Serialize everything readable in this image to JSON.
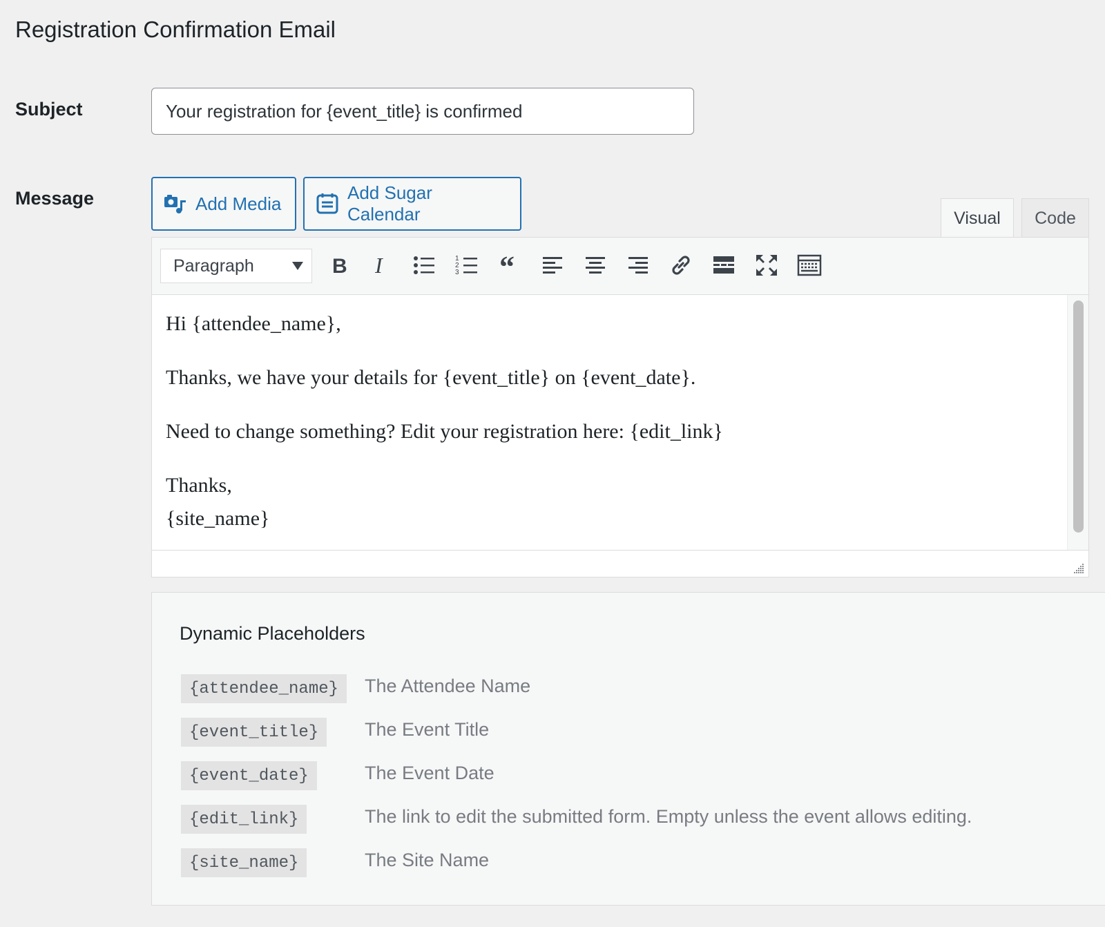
{
  "page_title": "Registration Confirmation Email",
  "subject": {
    "label": "Subject",
    "value": "Your registration for {event_title} is confirmed"
  },
  "message": {
    "label": "Message",
    "buttons": {
      "add_media": "Add Media",
      "add_sugar_calendar": "Add Sugar Calendar"
    },
    "tabs": {
      "visual": "Visual",
      "code": "Code",
      "active": "visual"
    },
    "toolbar": {
      "format_select": "Paragraph",
      "buttons": [
        "bold-icon",
        "italic-icon",
        "bulleted-list-icon",
        "numbered-list-icon",
        "blockquote-icon",
        "align-left-icon",
        "align-center-icon",
        "align-right-icon",
        "link-icon",
        "read-more-icon",
        "fullscreen-icon",
        "toolbar-toggle-icon"
      ]
    },
    "content": {
      "line1": "Hi {attendee_name},",
      "line2": "Thanks, we have your details for {event_title} on {event_date}.",
      "line3": "Need to change something? Edit your registration here: {edit_link}",
      "line4": "Thanks,",
      "line5": "{site_name}"
    }
  },
  "placeholders": {
    "title": "Dynamic Placeholders",
    "items": [
      {
        "code": "{attendee_name}",
        "description": "The Attendee Name"
      },
      {
        "code": "{event_title}",
        "description": "The Event Title"
      },
      {
        "code": "{event_date}",
        "description": "The Event Date"
      },
      {
        "code": "{edit_link}",
        "description": "The link to edit the submitted form. Empty unless the event allows editing."
      },
      {
        "code": "{site_name}",
        "description": "The Site Name"
      }
    ]
  },
  "colors": {
    "accent": "#2271b1",
    "background": "#f0f0f1",
    "text": "#1d2327",
    "muted": "#787c82"
  }
}
